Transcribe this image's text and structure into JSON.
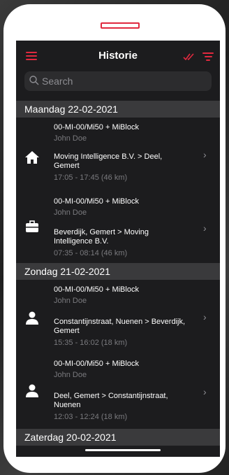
{
  "header": {
    "title": "Historie"
  },
  "icons": {
    "menu": "menu-icon",
    "check": "double-check-icon",
    "filter": "filter-icon"
  },
  "colors": {
    "accent": "#e0293f",
    "background": "#1c1c1e",
    "section": "#3a3a3c"
  },
  "search": {
    "placeholder": "Search"
  },
  "days": [
    {
      "label": "Maandag 22-02-2021",
      "trips": [
        {
          "icon": "home-icon",
          "vehicle": "00-MI-00/Mi50 + MiBlock",
          "driver": "John Doe",
          "route": "Moving Intelligence B.V. > Deel, Gemert",
          "time": "17:05 - 17:45 (46 km)"
        },
        {
          "icon": "briefcase-icon",
          "vehicle": "00-MI-00/Mi50 + MiBlock",
          "driver": "John Doe",
          "route": "Beverdijk, Gemert > Moving Intelligence B.V.",
          "time": "07:35 - 08:14 (46 km)"
        }
      ]
    },
    {
      "label": "Zondag 21-02-2021",
      "trips": [
        {
          "icon": "person-icon",
          "vehicle": "00-MI-00/Mi50 + MiBlock",
          "driver": "John Doe",
          "route": "Constantijnstraat, Nuenen > Beverdijk, Gemert",
          "time": "15:35 - 16:02 (18 km)"
        },
        {
          "icon": "person-icon",
          "vehicle": "00-MI-00/Mi50 + MiBlock",
          "driver": "John Doe",
          "route": "Deel, Gemert > Constantijnstraat, Nuenen",
          "time": "12:03 - 12:24 (18 km)"
        }
      ]
    },
    {
      "label": "Zaterdag 20-02-2021",
      "trips": []
    }
  ]
}
